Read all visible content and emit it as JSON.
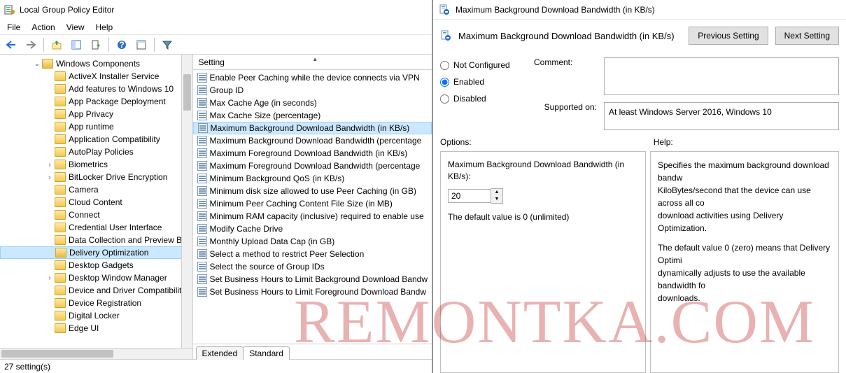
{
  "gpedit": {
    "title": "Local Group Policy Editor",
    "menu": {
      "file": "File",
      "action": "Action",
      "view": "View",
      "help": "Help"
    },
    "tree": {
      "root": "Windows Components",
      "items": [
        "ActiveX Installer Service",
        "Add features to Windows 10",
        "App Package Deployment",
        "App Privacy",
        "App runtime",
        "Application Compatibility",
        "AutoPlay Policies",
        "Biometrics",
        "BitLocker Drive Encryption",
        "Camera",
        "Cloud Content",
        "Connect",
        "Credential User Interface",
        "Data Collection and Preview Bu",
        "Delivery Optimization",
        "Desktop Gadgets",
        "Desktop Window Manager",
        "Device and Driver Compatibility",
        "Device Registration",
        "Digital Locker",
        "Edge UI"
      ],
      "expandable": [
        7,
        8,
        16
      ],
      "selected": 14
    },
    "list": {
      "header": "Setting",
      "items": [
        "Enable Peer Caching while the device connects via VPN",
        "Group ID",
        "Max Cache Age (in seconds)",
        "Max Cache Size (percentage)",
        "Maximum Background Download Bandwidth (in KB/s)",
        "Maximum Background Download Bandwidth (percentage",
        "Maximum Foreground Download Bandwidth (in KB/s)",
        "Maximum Foreground Download Bandwidth (percentage",
        "Minimum Background QoS (in KB/s)",
        "Minimum disk size allowed to use Peer Caching (in GB)",
        "Minimum Peer Caching Content File Size (in MB)",
        "Minimum RAM capacity (inclusive) required to enable use",
        "Modify Cache Drive",
        "Monthly Upload Data Cap (in GB)",
        "Select a method to restrict Peer Selection",
        "Select the source of Group IDs",
        "Set Business Hours to Limit Background Download Bandw",
        "Set Business Hours to Limit Foreground Download Bandw"
      ],
      "selected": 4
    },
    "tabs": {
      "extended": "Extended",
      "standard": "Standard"
    },
    "status": "27 setting(s)"
  },
  "dialog": {
    "title": "Maximum Background Download Bandwidth (in KB/s)",
    "heading": "Maximum Background Download Bandwidth (in KB/s)",
    "prev": "Previous Setting",
    "next": "Next Setting",
    "radio": {
      "not_configured": "Not Configured",
      "enabled": "Enabled",
      "disabled": "Disabled"
    },
    "comment_label": "Comment:",
    "supported_label": "Supported on:",
    "supported_text": "At least Windows Server 2016, Windows 10",
    "options_label": "Options:",
    "help_label": "Help:",
    "option_field_label": "Maximum Background Download Bandwidth (in KB/s):",
    "option_value": "20",
    "option_note": "The default value is 0 (unlimited)",
    "help_p1": "Specifies the maximum background download bandw",
    "help_p2": "KiloBytes/second that the device can use across all co",
    "help_p3": "download activities using Delivery Optimization.",
    "help_p4": "The default value 0 (zero) means that Delivery Optimi",
    "help_p5": "dynamically adjusts to use the available bandwidth fo",
    "help_p6": "downloads."
  },
  "watermark": "REMONTKA.COM"
}
